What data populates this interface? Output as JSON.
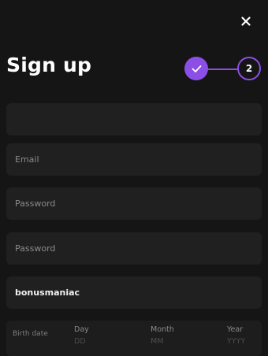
{
  "header": {
    "title": "Sign up",
    "close_icon": "close-icon"
  },
  "stepper": {
    "step1_icon": "checkmark-icon",
    "step2_label": "2",
    "accent_color": "#8c4fe6"
  },
  "form": {
    "first_field": {
      "value": "",
      "placeholder": ""
    },
    "email": {
      "placeholder": "Email"
    },
    "password": {
      "placeholder": "Password"
    },
    "password_repeat": {
      "placeholder": "Password"
    },
    "username": {
      "value": "bonusmaniac"
    },
    "birth_date": {
      "label": "Birth date",
      "day": {
        "label": "Day",
        "placeholder": "DD"
      },
      "month": {
        "label": "Month",
        "placeholder": "MM"
      },
      "year": {
        "label": "Year",
        "placeholder": "YYYY"
      }
    }
  }
}
